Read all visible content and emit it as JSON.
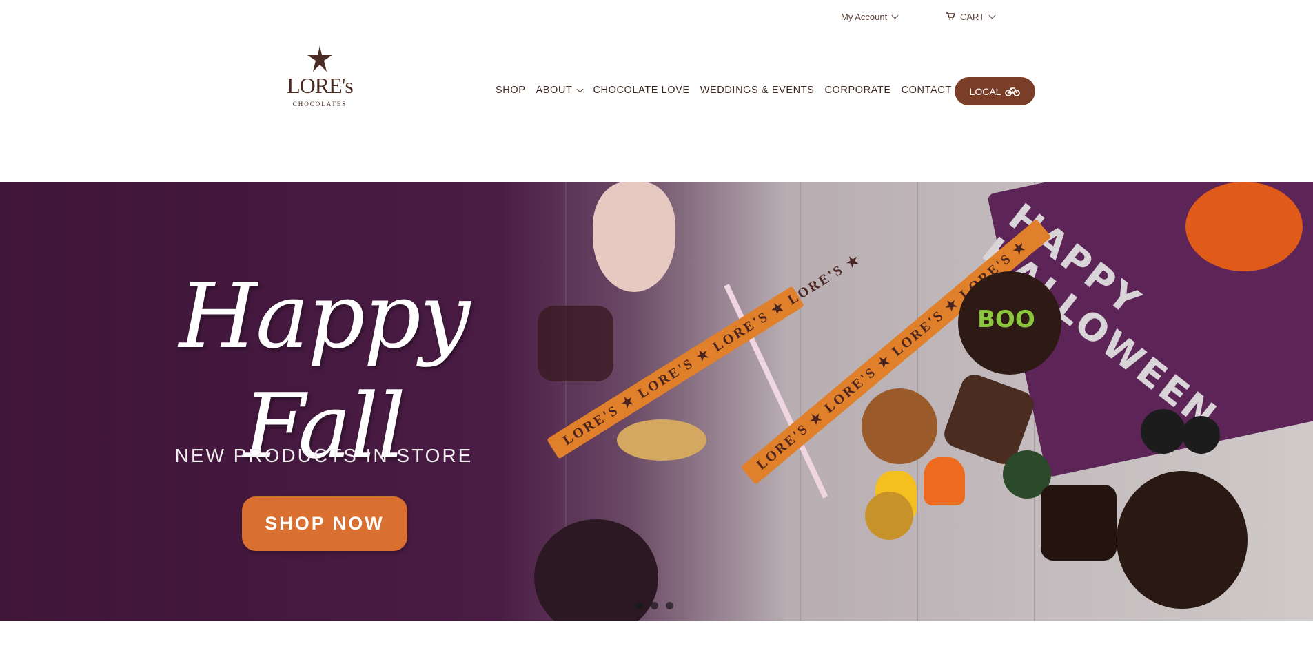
{
  "topbar": {
    "account_label": "My Account",
    "cart_label": "CART"
  },
  "logo": {
    "word": "LORE's",
    "sub": "CHOCOLATES"
  },
  "nav": {
    "items": [
      {
        "label": "SHOP"
      },
      {
        "label": "ABOUT"
      },
      {
        "label": "CHOCOLATE LOVE"
      },
      {
        "label": "WEDDINGS & EVENTS"
      },
      {
        "label": "CORPORATE"
      },
      {
        "label": "CONTACT"
      }
    ],
    "local_label": "LOCAL"
  },
  "hero": {
    "title": "Happy Fall",
    "subtitle": "NEW PRODUCTS IN STORE",
    "cta": "SHOP NOW",
    "ribbon_text": "LORE'S ★ LORE'S ★ LORE'S ★ LORE'S ★",
    "box_text": "HAPPY HALLOWEEN",
    "candy_text": "BOO",
    "slides": 3,
    "active_slide": 1
  },
  "colors": {
    "brand_brown": "#7a3e28",
    "cta_orange": "#d96f30",
    "hero_purple": "#3f1538"
  },
  "icons": [
    "chevron-down-icon",
    "cart-icon",
    "star-logo-icon",
    "bicycle-icon"
  ]
}
